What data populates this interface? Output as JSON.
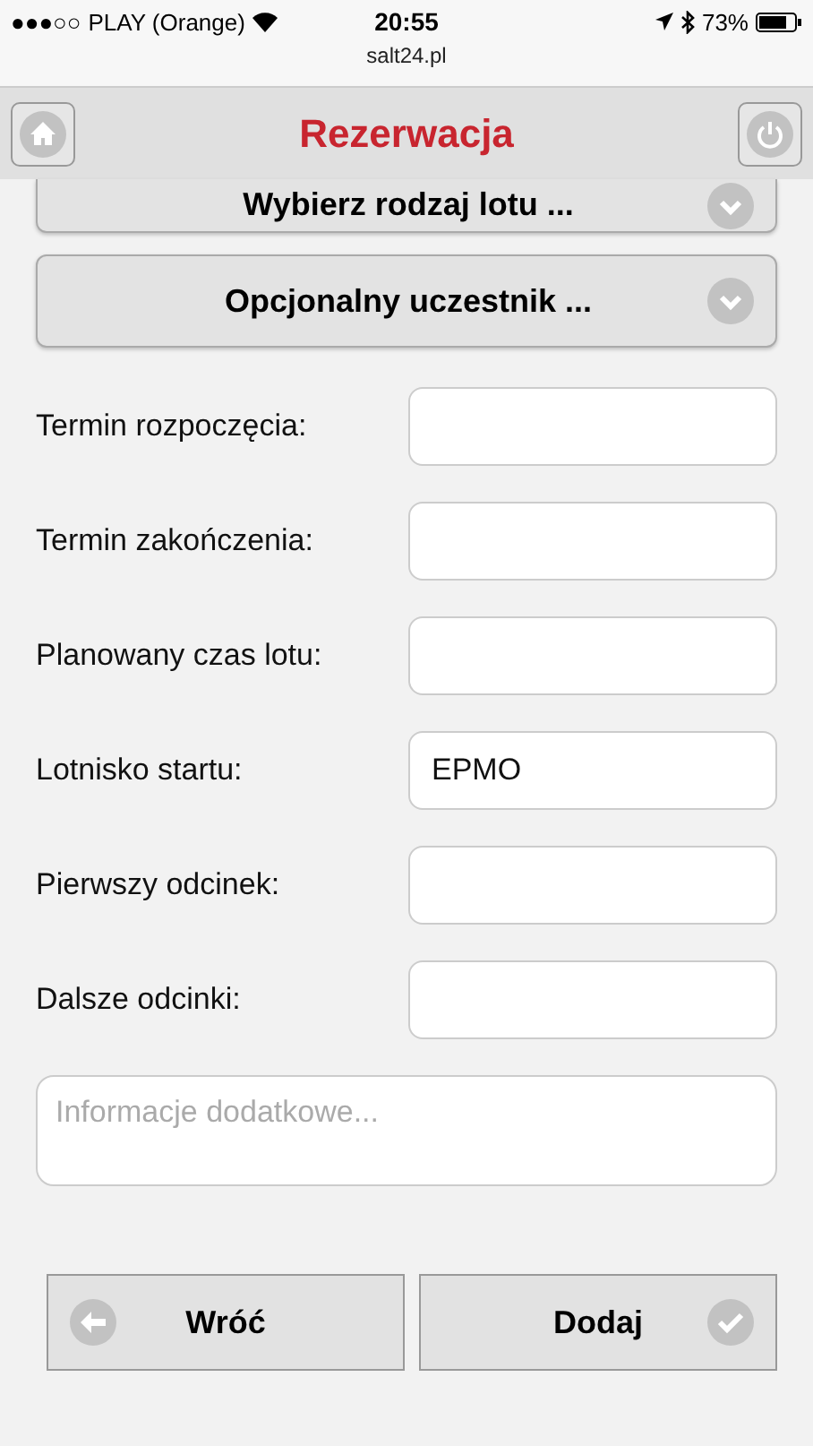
{
  "status_bar": {
    "signal": "●●●○○",
    "carrier": "PLAY (Orange)",
    "time": "20:55",
    "battery": "73%"
  },
  "url": "salt24.pl",
  "header": {
    "title": "Rezerwacja"
  },
  "selects": [
    {
      "label": "Wybierz rodzaj lotu ..."
    },
    {
      "label": "Opcjonalny uczestnik ..."
    }
  ],
  "fields": [
    {
      "label": "Termin rozpoczęcia:"
    },
    {
      "label": "Termin zakończenia:"
    },
    {
      "label": "Planowany czas lotu:"
    },
    {
      "label": "Lotnisko startu:",
      "value": "EPMO"
    },
    {
      "label": "Pierwszy odcinek:"
    },
    {
      "label": "Dalsze odcinki:"
    }
  ],
  "notes": {
    "placeholder": "Informacje dodatkowe..."
  },
  "buttons": [
    {
      "label": "Wróć",
      "kind": "back"
    },
    {
      "label": "Dodaj",
      "kind": "add"
    }
  ]
}
